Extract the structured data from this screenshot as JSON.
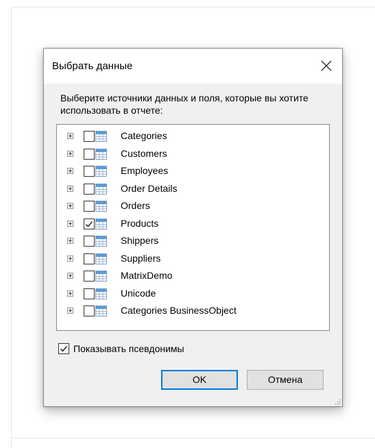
{
  "dialog": {
    "title": "Выбрать данные",
    "prompt": "Выберите источники данных и поля, которые вы хотите использовать в отчете:",
    "tree_items": [
      {
        "label": "Categories",
        "checked": false
      },
      {
        "label": "Customers",
        "checked": false
      },
      {
        "label": "Employees",
        "checked": false
      },
      {
        "label": "Order Details",
        "checked": false
      },
      {
        "label": "Orders",
        "checked": false
      },
      {
        "label": "Products",
        "checked": true
      },
      {
        "label": "Shippers",
        "checked": false
      },
      {
        "label": "Suppliers",
        "checked": false
      },
      {
        "label": "MatrixDemo",
        "checked": false
      },
      {
        "label": "Unicode",
        "checked": false
      },
      {
        "label": "Categories BusinessObject",
        "checked": false
      }
    ],
    "show_aliases": {
      "label": "Показывать псевдонимы",
      "checked": true
    },
    "ok_label": "OK",
    "cancel_label": "Отмена"
  },
  "colors": {
    "accent": "#0078d7",
    "table_icon_header": "#5b9bd5"
  }
}
